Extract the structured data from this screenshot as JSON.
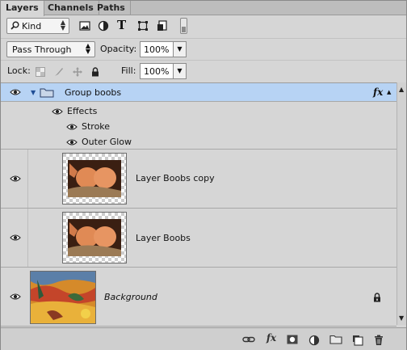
{
  "tabs": [
    {
      "label": "Layers",
      "active": true
    },
    {
      "label": "Channels",
      "active": false
    },
    {
      "label": "Paths",
      "active": false
    }
  ],
  "filter": {
    "kind_label": "Kind",
    "icons": [
      "pixel-filter-icon",
      "adjustment-filter-icon",
      "type-filter-icon",
      "shape-filter-icon",
      "smart-object-filter-icon"
    ],
    "type_glyph": "T"
  },
  "blend": {
    "mode": "Pass Through",
    "opacity_label": "Opacity:",
    "opacity_value": "100%",
    "lock_label": "Lock:",
    "fill_label": "Fill:",
    "fill_value": "100%"
  },
  "layers": [
    {
      "name": "Group boobs",
      "kind": "group",
      "selected": true,
      "fx_label": "fx",
      "effects_label": "Effects",
      "effects": [
        "Stroke",
        "Outer Glow"
      ]
    },
    {
      "name": "Layer Boobs copy",
      "kind": "layer"
    },
    {
      "name": "Layer Boobs",
      "kind": "layer"
    },
    {
      "name": "Background",
      "kind": "background",
      "locked": true
    }
  ],
  "footer": {
    "fx_label": "fx",
    "icons": [
      "link-layers-icon",
      "add-layer-style-icon",
      "add-mask-icon",
      "adjustment-layer-icon",
      "new-group-icon",
      "new-layer-icon",
      "delete-layer-icon"
    ]
  },
  "colors": {
    "selection": "#b7d3f4",
    "panel": "#d6d6d6"
  }
}
